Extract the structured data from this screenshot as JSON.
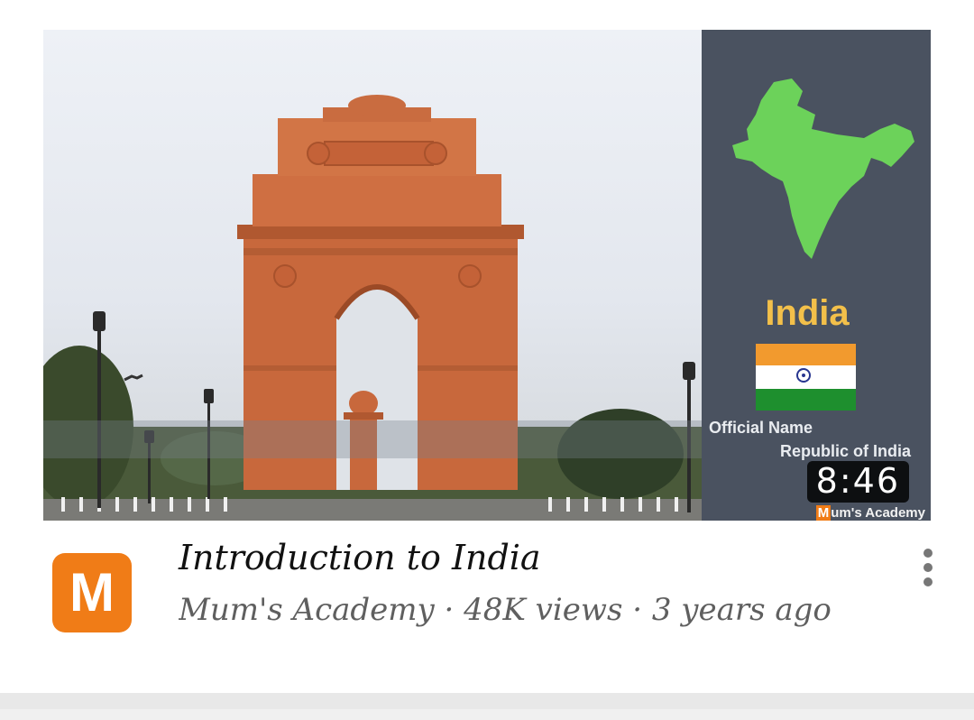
{
  "video": {
    "duration": "8:46",
    "thumbnail": {
      "country_name": "India",
      "official_name_label": "Official Name",
      "official_name_value": "Republic of India",
      "watermark_initial": "M",
      "watermark_rest": "um's Academy"
    },
    "title": "Introduction to India",
    "meta": "Mum's Academy · 48K views · 3 years ago"
  },
  "channel": {
    "avatar_letter": "M"
  },
  "colors": {
    "accent_orange": "#f07c17",
    "panel_bg": "#4a5260",
    "map_green": "#6cd25a"
  },
  "icons": {
    "menu": "more-vert-icon"
  }
}
